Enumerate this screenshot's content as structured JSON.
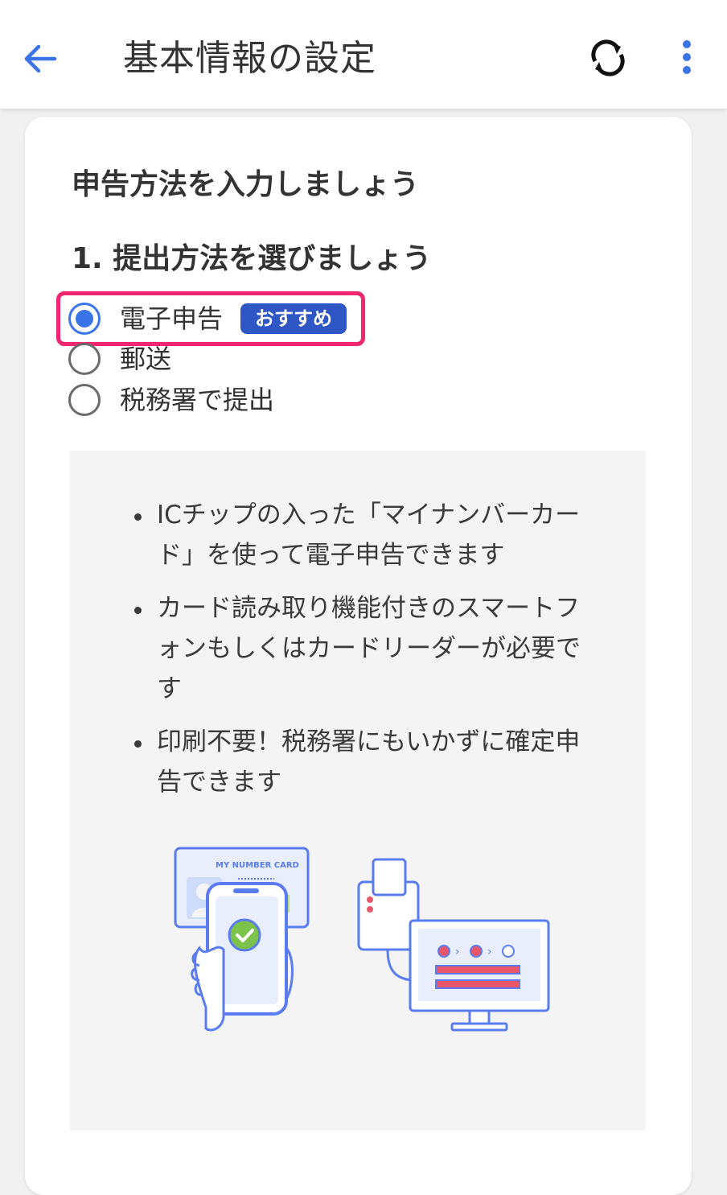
{
  "appbar": {
    "title": "基本情報の設定",
    "back_icon": "arrow-left-icon",
    "sync_icon": "sync-icon",
    "more_icon": "more-vertical-icon"
  },
  "card": {
    "heading": "申告方法を入力しましょう",
    "step_heading": "1. 提出方法を選びましょう",
    "options": [
      {
        "label": "電子申告",
        "selected": true,
        "badge": "おすすめ"
      },
      {
        "label": "郵送",
        "selected": false
      },
      {
        "label": "税務署で提出",
        "selected": false
      }
    ],
    "info": {
      "bullets": [
        "ICチップの入った「マイナンバーカード」を使って電子申告できます",
        "カード読み取り機能付きのスマートフォンもしくはカードリーダーが必要です",
        "印刷不要！税務署にもいかずに確定申告できます"
      ],
      "card_text": "MY NUMBER CARD"
    }
  },
  "colors": {
    "accent_blue": "#3b73e8",
    "badge_blue": "#2e56c4",
    "highlight_pink": "#f0266f",
    "illustration_blue": "#5b7cf0",
    "illustration_red": "#e8566a"
  }
}
